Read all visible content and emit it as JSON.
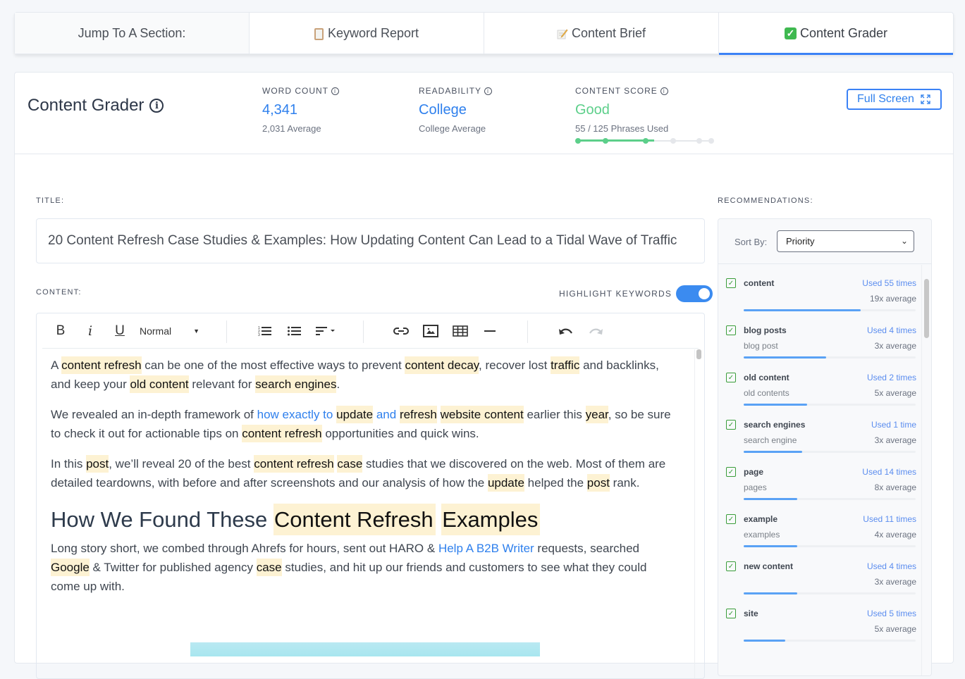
{
  "tabs": [
    {
      "label": "Jump To A Section:",
      "icon": "none",
      "active": false
    },
    {
      "label": "Keyword Report",
      "icon": "clipboard-icon",
      "active": false
    },
    {
      "label": "Content Brief",
      "icon": "memo-icon",
      "active": false
    },
    {
      "label": "Content Grader",
      "icon": "check-mark-icon",
      "active": true
    }
  ],
  "header": {
    "title": "Content Grader",
    "metrics": {
      "word_count": {
        "label": "WORD COUNT",
        "value": "4,341",
        "sub": "2,031 Average"
      },
      "readability": {
        "label": "READABILITY",
        "value": "College",
        "sub": "College Average"
      },
      "content_score": {
        "label": "CONTENT SCORE",
        "value": "Good",
        "sub": "55 / 125 Phrases Used",
        "progress_steps_total": 6,
        "progress_steps_reached": 3
      }
    },
    "full_screen_label": "Full Screen"
  },
  "title_section": {
    "label": "TITLE:",
    "value": "20 Content Refresh Case Studies & Examples: How Updating Content Can Lead to a Tidal Wave of Traffic"
  },
  "content_section": {
    "label": "CONTENT:",
    "highlight_label": "HIGHLIGHT KEYWORDS",
    "highlight_on": true
  },
  "toolbar": {
    "bold": "B",
    "italic": "i",
    "underline": "U",
    "format_select": "Normal"
  },
  "editor": {
    "p1": [
      {
        "t": "A "
      },
      {
        "t": "content refresh",
        "hl": true
      },
      {
        "t": " can be one of the most effective ways to prevent "
      },
      {
        "t": "content decay",
        "hl": true
      },
      {
        "t": ", recover lost "
      },
      {
        "t": "traffic",
        "hl": true
      },
      {
        "t": " and backlinks, and keep your "
      },
      {
        "t": "old content",
        "hl": true
      },
      {
        "t": " relevant for "
      },
      {
        "t": "search engines",
        "hl": true
      },
      {
        "t": "."
      }
    ],
    "p2": [
      {
        "t": "We revealed an in-depth framework of "
      },
      {
        "t": "how exactly to",
        "link": true
      },
      {
        "t": " "
      },
      {
        "t": "update",
        "hl": true
      },
      {
        "t": " "
      },
      {
        "t": "and",
        "link": true
      },
      {
        "t": " "
      },
      {
        "t": "refresh",
        "hl": true
      },
      {
        "t": " "
      },
      {
        "t": "website content",
        "hl": true
      },
      {
        "t": " earlier this "
      },
      {
        "t": "year",
        "hl": true
      },
      {
        "t": ", so be sure to check it out for actionable tips on "
      },
      {
        "t": "content refresh",
        "hl": true
      },
      {
        "t": " opportunities and quick wins."
      }
    ],
    "p3": [
      {
        "t": "In this "
      },
      {
        "t": "post",
        "hl": true
      },
      {
        "t": ", we’ll reveal 20 of the best "
      },
      {
        "t": "content refresh",
        "hl": true
      },
      {
        "t": " "
      },
      {
        "t": "case",
        "hl": true
      },
      {
        "t": " studies that we discovered on the web. Most of them are detailed teardowns, with before and after screenshots and our analysis of how the "
      },
      {
        "t": "update",
        "hl": true
      },
      {
        "t": " helped the "
      },
      {
        "t": "post",
        "hl": true
      },
      {
        "t": " rank."
      }
    ],
    "h2": [
      {
        "t": "How We Found These "
      },
      {
        "t": "Content Refresh",
        "hl": true
      },
      {
        "t": " "
      },
      {
        "t": "Examples",
        "hl": true
      }
    ],
    "p4": [
      {
        "t": "Long story short, we combed through Ahrefs for hours, sent out HARO & "
      },
      {
        "t": "Help A B2B Writer",
        "link": true
      },
      {
        "t": " requests, searched "
      },
      {
        "t": "Google",
        "hl": true
      },
      {
        "t": " & Twitter for published agency "
      },
      {
        "t": "case",
        "hl": true
      },
      {
        "t": " studies, and hit up our friends and customers to see what they could come up with."
      }
    ]
  },
  "recommendations": {
    "label": "RECOMMENDATIONS:",
    "sort_label": "Sort By:",
    "sort_value": "Priority",
    "items": [
      {
        "name": "content",
        "used": "Used 55 times",
        "alt": "",
        "avg": "19x average",
        "progress": 0.68,
        "checked": true
      },
      {
        "name": "blog posts",
        "used": "Used 4 times",
        "alt": "blog post",
        "avg": "3x average",
        "progress": 0.48,
        "checked": true
      },
      {
        "name": "old content",
        "used": "Used 2 times",
        "alt": "old contents",
        "avg": "5x average",
        "progress": 0.37,
        "checked": true
      },
      {
        "name": "search engines",
        "used": "Used 1 time",
        "alt": "search engine",
        "avg": "3x average",
        "progress": 0.34,
        "checked": true
      },
      {
        "name": "page",
        "used": "Used 14 times",
        "alt": "pages",
        "avg": "8x average",
        "progress": 0.31,
        "checked": true
      },
      {
        "name": "example",
        "used": "Used 11 times",
        "alt": "examples",
        "avg": "4x average",
        "progress": 0.31,
        "checked": true
      },
      {
        "name": "new content",
        "used": "Used 4 times",
        "alt": "",
        "avg": "3x average",
        "progress": 0.31,
        "checked": true
      },
      {
        "name": "site",
        "used": "Used 5 times",
        "alt": "",
        "avg": "5x average",
        "progress": 0.24,
        "checked": true
      }
    ]
  }
}
